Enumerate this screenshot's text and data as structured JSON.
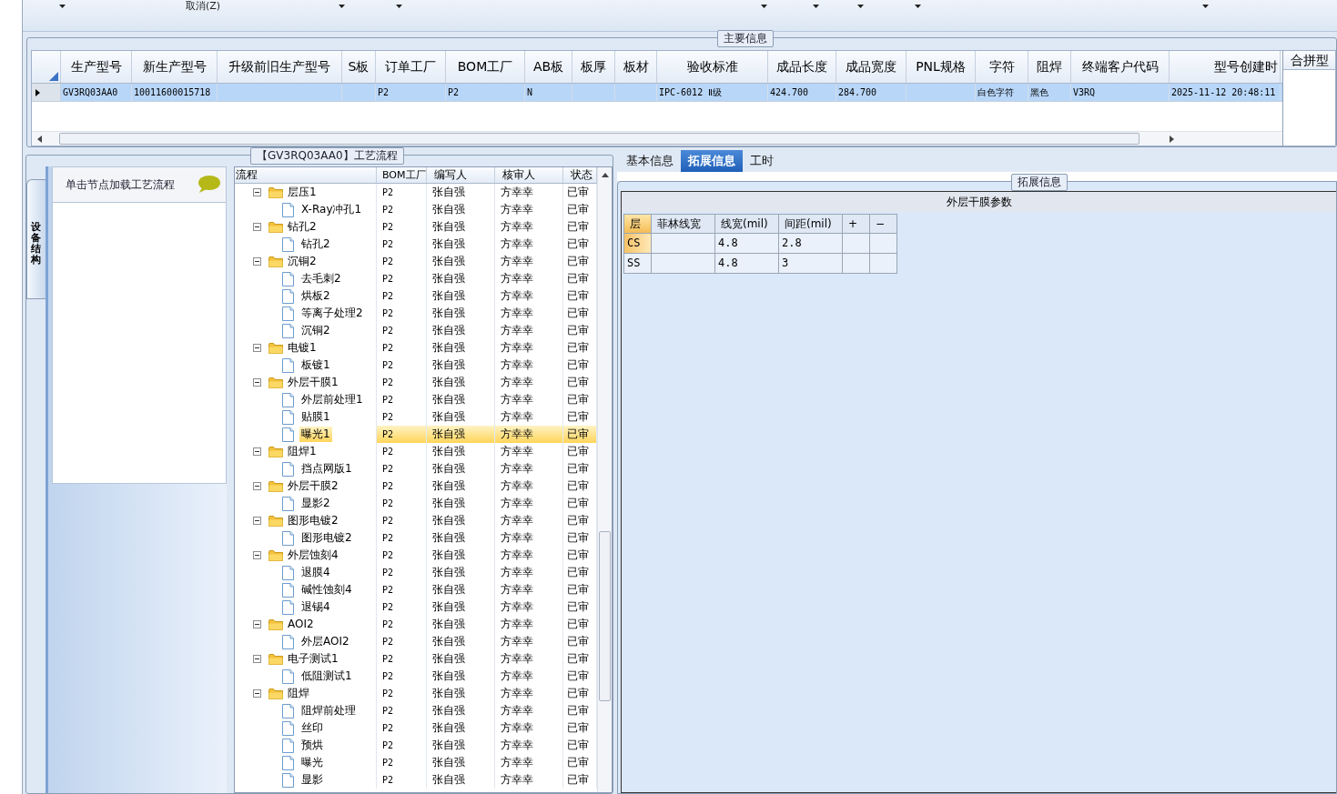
{
  "toolbar": [
    {
      "kind": "dropdown"
    },
    {
      "kind": "button",
      "label": "取消(Z)"
    },
    {
      "kind": "dropdown"
    },
    {
      "kind": "dropdown"
    },
    {
      "kind": "dropdown"
    },
    {
      "kind": "dropdown"
    },
    {
      "kind": "dropdown"
    },
    {
      "kind": "dropdown"
    },
    {
      "kind": "dropdown"
    }
  ],
  "main_info": {
    "title": "主要信息",
    "columns": [
      "生产型号",
      "新生产型号",
      "升级前旧生产型号",
      "S板",
      "订单工厂",
      "BOM工厂",
      "AB板",
      "板厚",
      "板材",
      "验收标准",
      "成品长度",
      "成品宽度",
      "PNL规格",
      "字符",
      "阻焊",
      "终端客户代码",
      "型号创建时"
    ],
    "rows": [
      {
        "selected": true,
        "cells": [
          "GV3RQ03AA0",
          "10011600015718",
          "",
          "",
          "P2",
          "P2",
          "N",
          "",
          "",
          "IPC-6012 Ⅱ级",
          "424.700",
          "284.700",
          "",
          "白色字符",
          "黑色",
          "V3RQ",
          "2025-11-12 20:48:11"
        ]
      }
    ],
    "side_column": "合拼型"
  },
  "process": {
    "title": "【GV3RQ03AA0】工艺流程",
    "side_tab": "设备结构",
    "hint": "单击节点加载工艺流程",
    "columns": [
      "流程",
      "BOM工厂",
      "编写人",
      "核审人",
      "状态"
    ],
    "nodes": [
      {
        "name": "层压1",
        "bom": "P2",
        "writer": "张自强",
        "reviewer": "方幸幸",
        "status": "已审",
        "expanded": true,
        "selected": false,
        "children": [
          {
            "name": "X-Ray冲孔1",
            "bom": "P2",
            "writer": "张自强",
            "reviewer": "方幸幸",
            "status": "已审",
            "selected": false
          }
        ]
      },
      {
        "name": "钻孔2",
        "bom": "P2",
        "writer": "张自强",
        "reviewer": "方幸幸",
        "status": "已审",
        "expanded": true,
        "selected": false,
        "children": [
          {
            "name": "钻孔2",
            "bom": "P2",
            "writer": "张自强",
            "reviewer": "方幸幸",
            "status": "已审",
            "selected": false
          }
        ]
      },
      {
        "name": "沉铜2",
        "bom": "P2",
        "writer": "张自强",
        "reviewer": "方幸幸",
        "status": "已审",
        "expanded": true,
        "selected": false,
        "children": [
          {
            "name": "去毛刺2",
            "bom": "P2",
            "writer": "张自强",
            "reviewer": "方幸幸",
            "status": "已审",
            "selected": false
          },
          {
            "name": "烘板2",
            "bom": "P2",
            "writer": "张自强",
            "reviewer": "方幸幸",
            "status": "已审",
            "selected": false
          },
          {
            "name": "等离子处理2",
            "bom": "P2",
            "writer": "张自强",
            "reviewer": "方幸幸",
            "status": "已审",
            "selected": false
          },
          {
            "name": "沉铜2",
            "bom": "P2",
            "writer": "张自强",
            "reviewer": "方幸幸",
            "status": "已审",
            "selected": false
          }
        ]
      },
      {
        "name": "电镀1",
        "bom": "P2",
        "writer": "张自强",
        "reviewer": "方幸幸",
        "status": "已审",
        "expanded": true,
        "selected": false,
        "children": [
          {
            "name": "板镀1",
            "bom": "P2",
            "writer": "张自强",
            "reviewer": "方幸幸",
            "status": "已审",
            "selected": false
          }
        ]
      },
      {
        "name": "外层干膜1",
        "bom": "P2",
        "writer": "张自强",
        "reviewer": "方幸幸",
        "status": "已审",
        "expanded": true,
        "selected": false,
        "children": [
          {
            "name": "外层前处理1",
            "bom": "P2",
            "writer": "张自强",
            "reviewer": "方幸幸",
            "status": "已审",
            "selected": false
          },
          {
            "name": "贴膜1",
            "bom": "P2",
            "writer": "张自强",
            "reviewer": "方幸幸",
            "status": "已审",
            "selected": false
          },
          {
            "name": "曝光1",
            "bom": "P2",
            "writer": "张自强",
            "reviewer": "方幸幸",
            "status": "已审",
            "selected": true
          }
        ]
      },
      {
        "name": "阻焊1",
        "bom": "P2",
        "writer": "张自强",
        "reviewer": "方幸幸",
        "status": "已审",
        "expanded": true,
        "selected": false,
        "children": [
          {
            "name": "挡点网版1",
            "bom": "P2",
            "writer": "张自强",
            "reviewer": "方幸幸",
            "status": "已审",
            "selected": false
          }
        ]
      },
      {
        "name": "外层干膜2",
        "bom": "P2",
        "writer": "张自强",
        "reviewer": "方幸幸",
        "status": "已审",
        "expanded": true,
        "selected": false,
        "children": [
          {
            "name": "显影2",
            "bom": "P2",
            "writer": "张自强",
            "reviewer": "方幸幸",
            "status": "已审",
            "selected": false
          }
        ]
      },
      {
        "name": "图形电镀2",
        "bom": "P2",
        "writer": "张自强",
        "reviewer": "方幸幸",
        "status": "已审",
        "expanded": true,
        "selected": false,
        "children": [
          {
            "name": "图形电镀2",
            "bom": "P2",
            "writer": "张自强",
            "reviewer": "方幸幸",
            "status": "已审",
            "selected": false
          }
        ]
      },
      {
        "name": "外层蚀刻4",
        "bom": "P2",
        "writer": "张自强",
        "reviewer": "方幸幸",
        "status": "已审",
        "expanded": true,
        "selected": false,
        "children": [
          {
            "name": "退膜4",
            "bom": "P2",
            "writer": "张自强",
            "reviewer": "方幸幸",
            "status": "已审",
            "selected": false
          },
          {
            "name": "碱性蚀刻4",
            "bom": "P2",
            "writer": "张自强",
            "reviewer": "方幸幸",
            "status": "已审",
            "selected": false
          },
          {
            "name": "退锡4",
            "bom": "P2",
            "writer": "张自强",
            "reviewer": "方幸幸",
            "status": "已审",
            "selected": false
          }
        ]
      },
      {
        "name": "AOI2",
        "bom": "P2",
        "writer": "张自强",
        "reviewer": "方幸幸",
        "status": "已审",
        "expanded": true,
        "selected": false,
        "children": [
          {
            "name": "外层AOI2",
            "bom": "P2",
            "writer": "张自强",
            "reviewer": "方幸幸",
            "status": "已审",
            "selected": false
          }
        ]
      },
      {
        "name": "电子测试1",
        "bom": "P2",
        "writer": "张自强",
        "reviewer": "方幸幸",
        "status": "已审",
        "expanded": true,
        "selected": false,
        "children": [
          {
            "name": "低阻测试1",
            "bom": "P2",
            "writer": "张自强",
            "reviewer": "方幸幸",
            "status": "已审",
            "selected": false
          }
        ]
      },
      {
        "name": "阻焊",
        "bom": "P2",
        "writer": "张自强",
        "reviewer": "方幸幸",
        "status": "已审",
        "expanded": true,
        "selected": false,
        "children": [
          {
            "name": "阻焊前处理",
            "bom": "P2",
            "writer": "张自强",
            "reviewer": "方幸幸",
            "status": "已审",
            "selected": false
          },
          {
            "name": "丝印",
            "bom": "P2",
            "writer": "张自强",
            "reviewer": "方幸幸",
            "status": "已审",
            "selected": false
          },
          {
            "name": "预烘",
            "bom": "P2",
            "writer": "张自强",
            "reviewer": "方幸幸",
            "status": "已审",
            "selected": false
          },
          {
            "name": "曝光",
            "bom": "P2",
            "writer": "张自强",
            "reviewer": "方幸幸",
            "status": "已审",
            "selected": false
          },
          {
            "name": "显影",
            "bom": "P2",
            "writer": "张自强",
            "reviewer": "方幸幸",
            "status": "已审",
            "selected": false
          }
        ]
      }
    ]
  },
  "detail": {
    "tabs": [
      {
        "label": "基本信息",
        "selected": false
      },
      {
        "label": "拓展信息",
        "selected": true
      },
      {
        "label": "工时",
        "selected": false
      }
    ],
    "group_title": "拓展信息",
    "section_title": "外层干膜参数",
    "columns": [
      "层",
      "菲林线宽",
      "线宽(mil)",
      "间距(mil)",
      "+",
      "−"
    ],
    "rows": [
      {
        "selected": true,
        "cells": [
          "CS",
          "",
          "4.8",
          "2.8",
          "",
          ""
        ]
      },
      {
        "selected": false,
        "cells": [
          "SS",
          "",
          "4.8",
          "3",
          "",
          ""
        ]
      }
    ]
  }
}
